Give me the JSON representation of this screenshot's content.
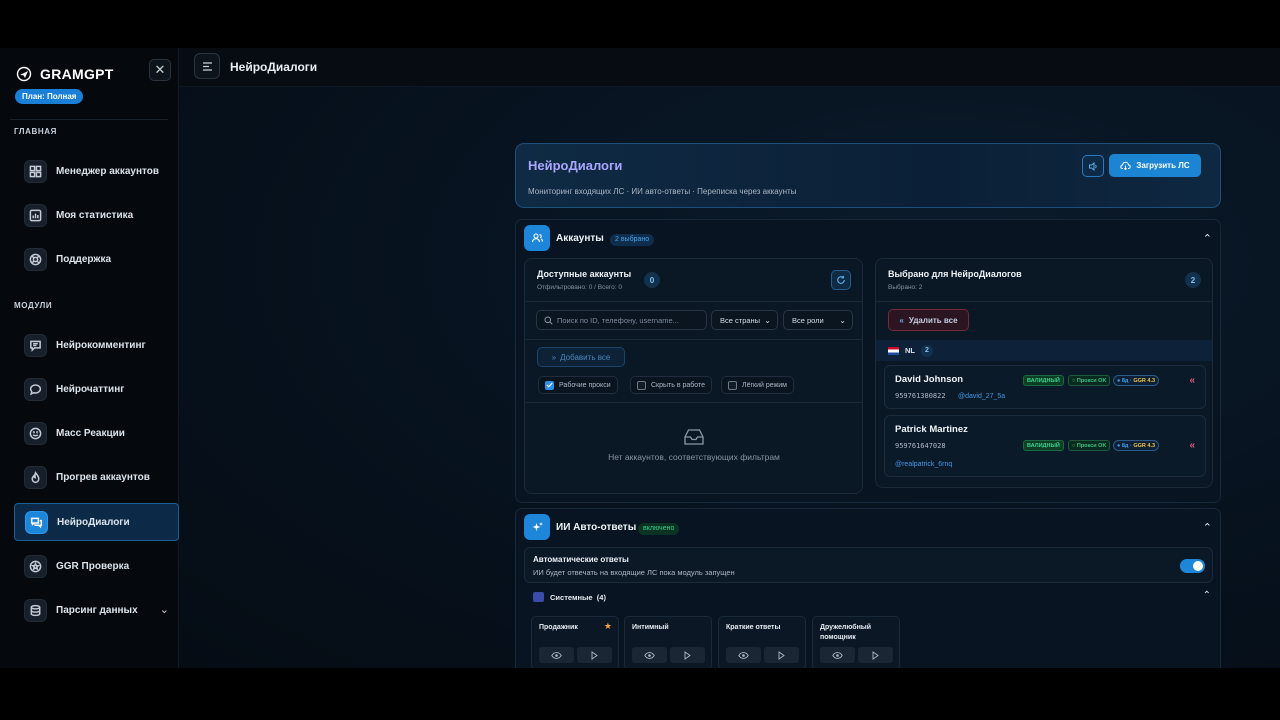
{
  "brand": {
    "name": "GRAMGPT",
    "plan": "План: Полная"
  },
  "sidebar": {
    "section_main": "ГЛАВНАЯ",
    "section_modules": "МОДУЛИ",
    "items": [
      {
        "label": "Менеджер аккаунтов",
        "icon": "grid-icon"
      },
      {
        "label": "Моя статистика",
        "icon": "bar-chart-icon"
      },
      {
        "label": "Поддержка",
        "icon": "lifebuoy-icon"
      },
      {
        "label": "Нейрокомментинг",
        "icon": "comments-icon"
      },
      {
        "label": "Нейрочаттинг",
        "icon": "chat-bubble-icon"
      },
      {
        "label": "Масс Реакции",
        "icon": "smile-icon"
      },
      {
        "label": "Прогрев аккаунтов",
        "icon": "flame-icon"
      },
      {
        "label": "НейроДиалоги",
        "icon": "dialogs-icon",
        "active": true
      },
      {
        "label": "GGR Проверка",
        "icon": "star-badge-icon"
      },
      {
        "label": "Парсинг данных",
        "icon": "database-icon"
      }
    ]
  },
  "topbar": {
    "title": "НейроДиалоги"
  },
  "header": {
    "title": "НейроДиалоги",
    "subtitle": "Мониторинг входящих ЛС · ИИ авто-ответы · Переписка через аккаунты",
    "load_button": "Загрузить ЛС"
  },
  "accounts_section": {
    "title": "Аккаунты",
    "badge": "2 выбрано",
    "available": {
      "title": "Доступные аккаунты",
      "subtitle": "Отфильтровано: 0 / Всего: 0",
      "count": "0",
      "search_placeholder": "Поиск по ID, телефону, username...",
      "country_select": "Все страны",
      "role_select": "Все роли",
      "add_all": "Добавить все",
      "filters": [
        {
          "label": "Рабочие прокси",
          "checked": true
        },
        {
          "label": "Скрыть в работе",
          "checked": false
        },
        {
          "label": "Лёгкий режим",
          "checked": false
        }
      ],
      "empty_text": "Нет аккаунтов, соответствующих фильтрам"
    },
    "selected": {
      "title": "Выбрано для НейроДиалогов",
      "subtitle": "Выбрано: 2",
      "count": "2",
      "remove_all": "Удалить все",
      "group": {
        "country": "NL",
        "count": "2"
      },
      "accounts": [
        {
          "name": "David Johnson",
          "phone": "959761380822",
          "username": "@david_27_5a",
          "status": "ВАЛИДНЫЙ",
          "proxy": "Прокси OK",
          "age": "8д",
          "ggr": "GGR 4.3"
        },
        {
          "name": "Patrick Martinez",
          "phone": "959761647028",
          "username": "@realpatrick_6rnq",
          "status": "ВАЛИДНЫЙ",
          "proxy": "Прокси OK",
          "age": "8д",
          "ggr": "GGR 4.3"
        }
      ]
    }
  },
  "ai_section": {
    "title": "ИИ Авто-ответы",
    "badge": "включено",
    "toggle_title": "Автоматические ответы",
    "toggle_sub": "ИИ будет отвечать на входящие ЛС пока модуль запущен",
    "toggle_on": true,
    "system_label": "Системные",
    "system_count": "(4)",
    "templates": [
      {
        "name": "Продажник",
        "starred": true
      },
      {
        "name": "Интимный",
        "starred": false
      },
      {
        "name": "Краткие ответы",
        "starred": false
      },
      {
        "name": "Дружелюбный помощник",
        "starred": false
      }
    ]
  },
  "colors": {
    "accent": "#1d86d8",
    "title_purple": "#a9a5ff",
    "valid_green": "#37d68f",
    "danger": "#e05b7a"
  }
}
